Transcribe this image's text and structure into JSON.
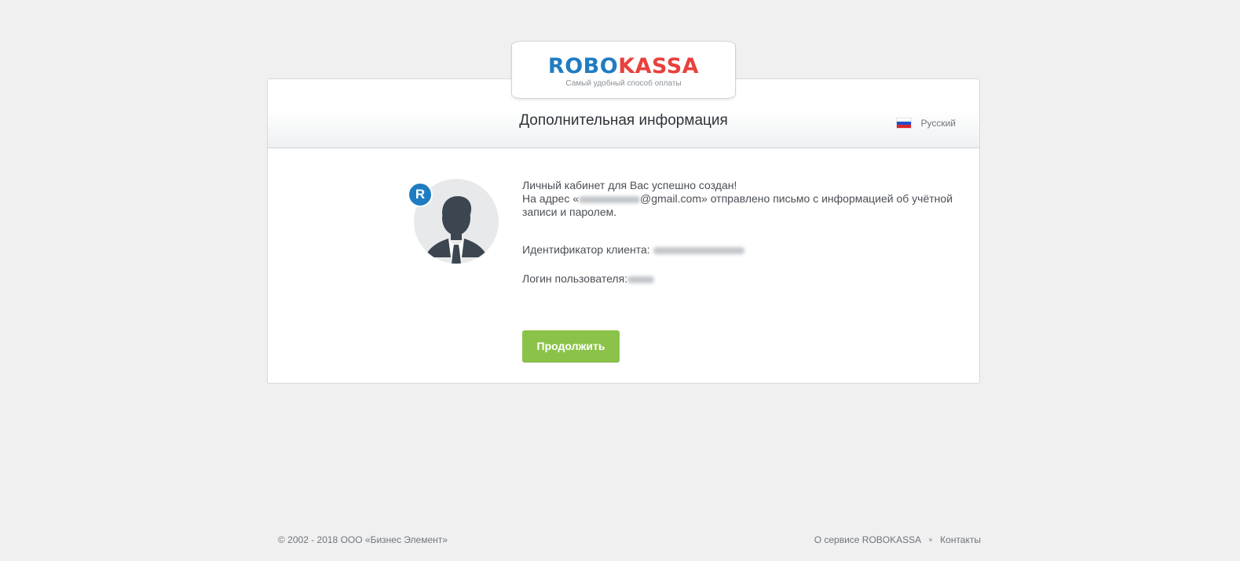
{
  "logo": {
    "part1": "ROBO",
    "part2": "KASSA",
    "tagline": "Самый удобный способ оплаты"
  },
  "header": {
    "title": "Дополнительная информация",
    "language": "Русский"
  },
  "badge": {
    "letter": "R"
  },
  "message": {
    "line1": "Личный кабинет для Вас успешно создан!",
    "address_prefix": "На адрес «",
    "email_visible": "@gmail.com",
    "address_suffix": "» отправлено письмо с информацией об учётной записи и паролем."
  },
  "fields": {
    "client_id_label": "Идентификатор клиента:",
    "login_label": "Логин пользователя:"
  },
  "actions": {
    "continue_label": "Продолжить"
  },
  "footer": {
    "copyright": "© 2002 - 2018 ООО «Бизнес Элемент»",
    "about_link": "О сервисе ROBOKASSA",
    "contacts_link": "Контакты"
  },
  "colors": {
    "brand_blue": "#1f7cc3",
    "brand_red": "#e8413e",
    "button_green": "#8bc34a",
    "page_bg": "#f0f0f0"
  }
}
